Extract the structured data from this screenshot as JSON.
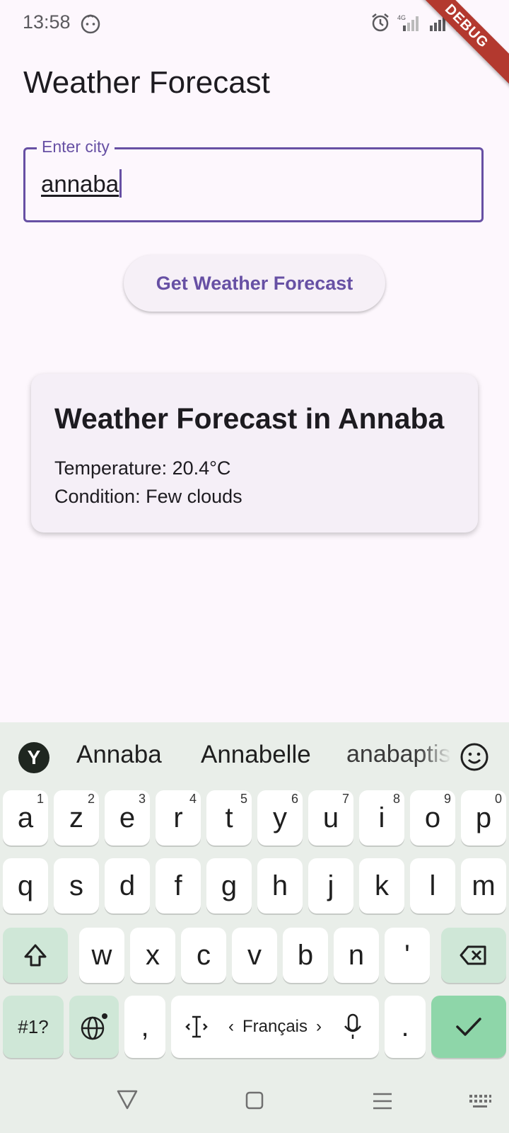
{
  "status_bar": {
    "time": "13:58"
  },
  "debug_banner": "DEBUG",
  "app": {
    "title": "Weather Forecast"
  },
  "city_field": {
    "label": "Enter city",
    "value": "annaba"
  },
  "action_button": {
    "label": "Get Weather Forecast"
  },
  "result_card": {
    "title": "Weather Forecast in Annaba",
    "temperature": "Temperature: 20.4°C",
    "condition": "Condition: Few clouds"
  },
  "keyboard": {
    "logo": "Y",
    "suggestions": [
      "Annaba",
      "Annabelle",
      "anabaptist"
    ],
    "row1": [
      {
        "k": "a",
        "h": "1"
      },
      {
        "k": "z",
        "h": "2"
      },
      {
        "k": "e",
        "h": "3"
      },
      {
        "k": "r",
        "h": "4"
      },
      {
        "k": "t",
        "h": "5"
      },
      {
        "k": "y",
        "h": "6"
      },
      {
        "k": "u",
        "h": "7"
      },
      {
        "k": "i",
        "h": "8"
      },
      {
        "k": "o",
        "h": "9"
      },
      {
        "k": "p",
        "h": "0"
      }
    ],
    "row2": [
      "q",
      "s",
      "d",
      "f",
      "g",
      "h",
      "j",
      "k",
      "l",
      "m"
    ],
    "row3": [
      "w",
      "x",
      "c",
      "v",
      "b",
      "n",
      "'"
    ],
    "symbols_label": "#1?",
    "comma": ",",
    "period": ".",
    "space_language": "Français"
  },
  "colors": {
    "accent": "#6750a4",
    "background": "#fdf7fd",
    "card": "#f5eff7",
    "keyboard_action": "#8ed6a9"
  }
}
